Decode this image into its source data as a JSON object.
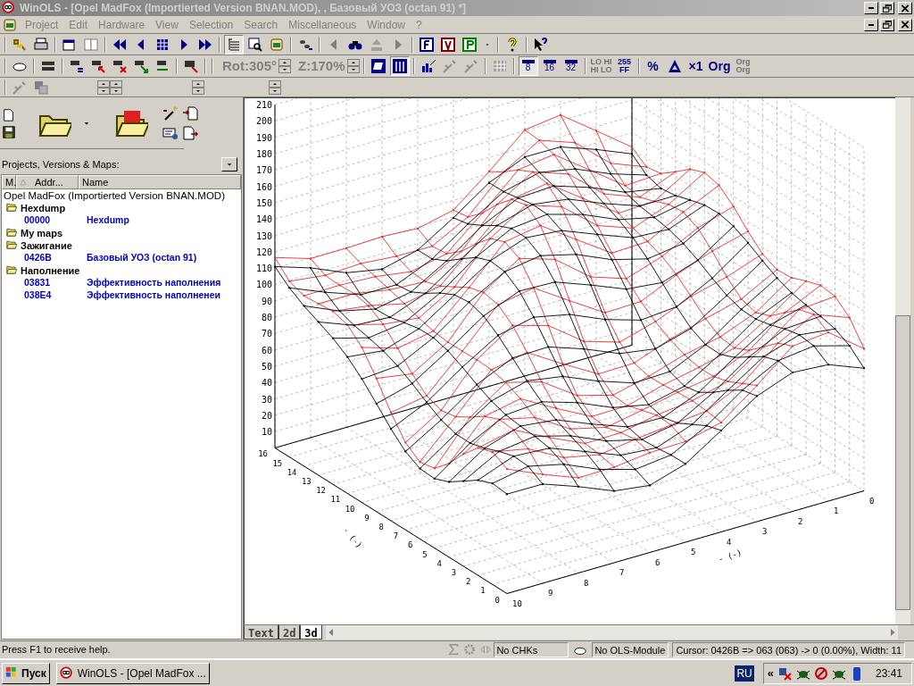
{
  "window": {
    "title": "WinOLS - [Opel MadFox (Importierted Version BNAN.MOD), , Базовый УОЗ (octan 91) *]"
  },
  "menu": [
    "Project",
    "Edit",
    "Hardware",
    "View",
    "Selection",
    "Search",
    "Miscellaneous",
    "Window",
    "?"
  ],
  "toolbar": {
    "rotation": {
      "label": "Rot:305°",
      "disabled": true
    },
    "zoom": {
      "label": "Z:170%",
      "disabled": true
    },
    "word_sizes": [
      {
        "label": "8",
        "selected": true
      },
      {
        "label": "16",
        "selected": false
      },
      {
        "label": "32",
        "selected": false
      }
    ],
    "formats": [
      {
        "lines": [
          "LO HI",
          "HI LO"
        ],
        "disabled": true
      },
      {
        "lines": [
          "255",
          "FF"
        ],
        "disabled": false
      },
      {
        "lines": [
          "%"
        ],
        "disabled": false
      },
      {
        "lines": [
          "×1"
        ],
        "disabled": false
      },
      {
        "lines": [
          "Org"
        ],
        "disabled": false
      },
      {
        "lines": [
          "Org",
          "Org"
        ],
        "disabled": true
      }
    ]
  },
  "project_panel": {
    "heading": "Projects, Versions & Maps:",
    "columns": [
      "M.",
      "Addr...",
      "Name"
    ],
    "root": "Opel MadFox (Importierted Version BNAN.MOD)",
    "folders": [
      {
        "label": "Hexdump",
        "children": [
          {
            "address": "00000",
            "name": "Hexdump"
          }
        ]
      },
      {
        "label": "My maps"
      },
      {
        "label": "Зажигание",
        "children": [
          {
            "address": "0426B",
            "name": "Базовый УОЗ (octan 91)"
          }
        ]
      },
      {
        "label": "Наполнение",
        "children": [
          {
            "address": "03831",
            "name": "Эффективность наполнения"
          },
          {
            "address": "038E4",
            "name": "Эффективность наполненеи"
          }
        ]
      }
    ]
  },
  "chart3d": {
    "z_ticks": [
      "210",
      "200",
      "190",
      "180",
      "170",
      "160",
      "150",
      "140",
      "130",
      "120",
      "110",
      "100",
      "90",
      "80",
      "70",
      "60",
      "50",
      "40",
      "30",
      "20",
      "10"
    ],
    "y_ticks": [
      "16",
      "15",
      "14",
      "13",
      "12",
      "11",
      "10",
      "9",
      "8",
      "7",
      "6",
      "5",
      "4",
      "3",
      "2",
      "1",
      "0"
    ],
    "x_ticks": [
      "10",
      "9",
      "8",
      "7",
      "6",
      "5",
      "4",
      "3",
      "2",
      "1",
      "0"
    ],
    "y_axis_label": "- (-)",
    "x_axis_label": "- (-)"
  },
  "tabs": [
    {
      "label": "Text",
      "selected": false
    },
    {
      "label": "2d",
      "selected": false
    },
    {
      "label": "3d",
      "selected": true
    }
  ],
  "status_bar": {
    "help": "Press F1 to receive help.",
    "checksum": "No CHKs",
    "module": "No OLS-Module",
    "cursor": "Cursor: 0426B => 063 (063) -> 0 (0.00%), Width: 11"
  },
  "taskbar": {
    "start": "Пуск",
    "tasks": [
      {
        "label": "WinOLS - [Opel MadFox ..."
      }
    ],
    "language": "RU",
    "expand": "«",
    "clock": "23:41"
  }
}
